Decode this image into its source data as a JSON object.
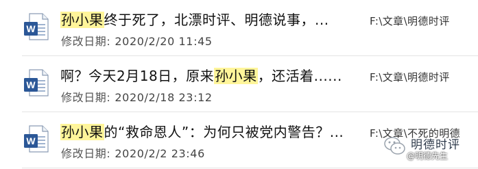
{
  "results": [
    {
      "icon": "word-document-icon",
      "title_highlight": "孙小果",
      "title_rest": "终于死了，北漂时评、明德说事，...",
      "title_prefix": "",
      "modified_label": "修改日期:",
      "modified_date": "2020/2/20 11:45",
      "path": "F:\\文章\\明德时评"
    },
    {
      "icon": "word-document-icon",
      "title_prefix": "啊？今天2月18日，原来",
      "title_highlight": "孙小果",
      "title_rest": "，还活着......",
      "modified_label": "修改日期:",
      "modified_date": "2020/2/18 23:12",
      "path": "F:\\文章\\明德时评"
    },
    {
      "icon": "word-document-icon",
      "title_prefix": "",
      "title_highlight": "孙小果",
      "title_rest": "的“救命恩人”：为何只被党内警告？...",
      "modified_label": "修改日期:",
      "modified_date": "2020/2/2 23:46",
      "path": "F:\\文章\\不死的明德"
    }
  ],
  "watermark": {
    "name": "明德时评",
    "handle": "@明德先生"
  },
  "colors": {
    "highlight": "#fff59a",
    "word_blue": "#2b5797"
  }
}
